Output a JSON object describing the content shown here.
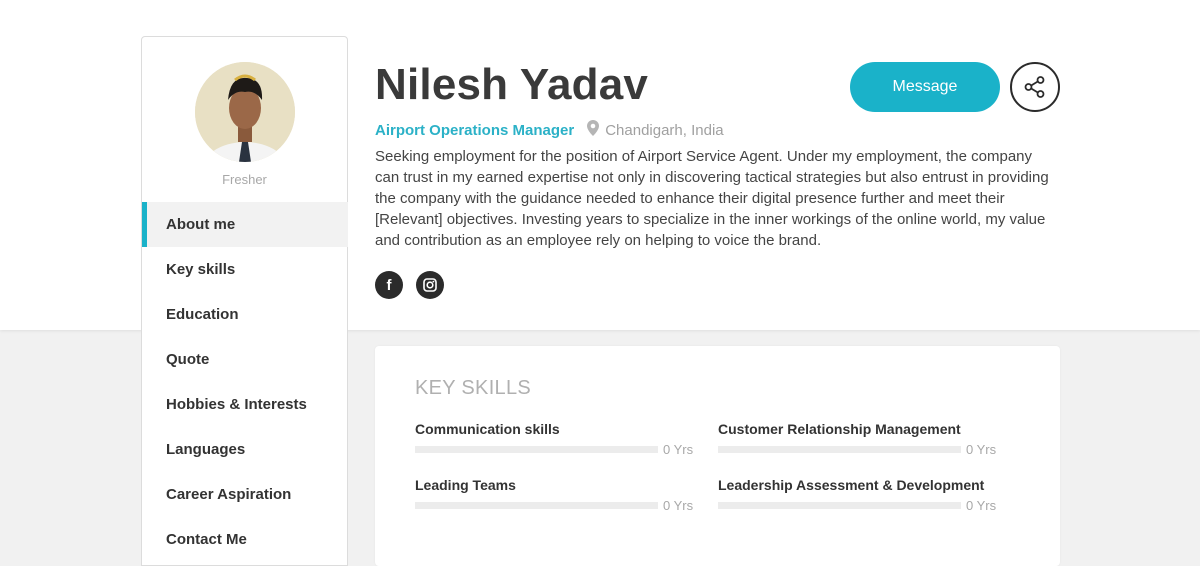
{
  "profile": {
    "experience_label": "Fresher",
    "name": "Nilesh Yadav",
    "role": "Airport Operations Manager",
    "location": "Chandigarh, India",
    "bio": "Seeking employment for the position of Airport Service Agent. Under my employment, the company can trust in my earned expertise not only in discovering tactical strategies but also entrust in providing the company with the guidance needed to enhance their digital presence further and meet their [Relevant] objectives. Investing years to specialize in the inner workings of the online world, my value and contribution as an employee rely on helping to voice the brand."
  },
  "actions": {
    "message_label": "Message",
    "share_icon": "share-icon"
  },
  "social": {
    "facebook_glyph": "f",
    "facebook_icon": "facebook-icon",
    "instagram_icon": "instagram-icon"
  },
  "nav": {
    "items": [
      {
        "label": "About me",
        "active": true
      },
      {
        "label": "Key skills"
      },
      {
        "label": "Education"
      },
      {
        "label": "Quote"
      },
      {
        "label": "Hobbies & Interests"
      },
      {
        "label": "Languages"
      },
      {
        "label": "Career Aspiration"
      },
      {
        "label": "Contact Me"
      }
    ]
  },
  "key_skills": {
    "title": "KEY SKILLS",
    "skills": [
      {
        "name": "Communication skills",
        "years": "0 Yrs",
        "level": 0
      },
      {
        "name": "Customer Relationship Management",
        "years": "0 Yrs",
        "level": 0
      },
      {
        "name": "Leading Teams",
        "years": "0 Yrs",
        "level": 0
      },
      {
        "name": "Leadership Assessment & Development",
        "years": "0 Yrs",
        "level": 0
      }
    ]
  },
  "colors": {
    "accent": "#1ab2c9",
    "role_text": "#2bb1c7",
    "dark": "#2b2b2b"
  }
}
